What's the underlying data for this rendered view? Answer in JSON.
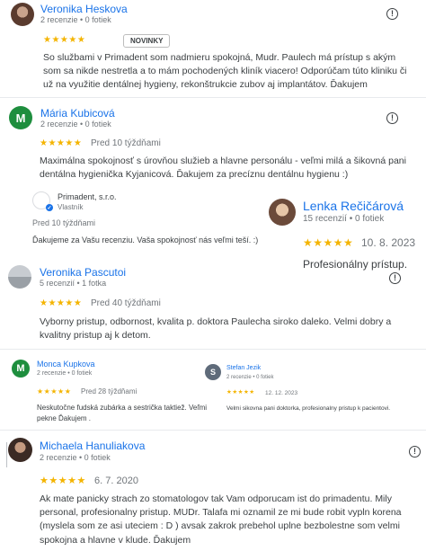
{
  "reviews": [
    {
      "author": "Veronika Heskova",
      "meta": "2 recenzie • 0 fotiek",
      "stars": "★★★★★",
      "badge": "NOVINKY",
      "text": "So službami v Primadent som nadmieru spokojná, Mudr. Paulech má prístup s akým som sa nikde nestretla a to mám pochodených kliník viacero! Odporúčam túto kliniku či už na využitie dentálnej hygieny, rekonštrukcie zubov aj implantátov. Ďakujem"
    },
    {
      "author": "Mária Kubicová",
      "initial": "M",
      "meta": "2 recenzie • 0 fotiek",
      "stars": "★★★★★",
      "date": "Pred 10 týždňami",
      "text": "Maximálna spokojnosť s úrovňou služieb a hlavne personálu - veľmi milá a šikovná pani dentálna hygienička Kyjanicová. Ďakujem za precíznu dentálnu hygienu :)"
    },
    {
      "owner_name": "Primadent, s.r.o.",
      "owner_role": "Vlastník",
      "owner_date": "Pred 10 týždňami",
      "owner_text": "Ďakujeme za Vašu recenziu. Vaša spokojnosť nás veľmi teší. :)"
    },
    {
      "author": "Lenka Rečičárová",
      "meta": "15 recenzií • 0 fotiek",
      "stars": "★★★★★",
      "date": "10. 8. 2023",
      "text": "Profesionálny prístup."
    },
    {
      "author": "Veronika Pascutoi",
      "meta": "5 recenzií • 1 fotka",
      "stars": "★★★★★",
      "date": "Pred 40 týždňami",
      "text": "Vyborny pristup, odbornost, kvalita p. doktora Paulecha siroko daleko. Velmi dobry a kvalitny pristup aj k detom."
    },
    {
      "author": "Monca Kupkova",
      "initial": "M",
      "meta": "2 recenzie • 0 fotiek",
      "stars": "★★★★★",
      "date": "Pred 28 týždňami",
      "text": "Neskutočne fudská zubárka a sestrička taktiež. Veľmi pekne Ďakujem ."
    },
    {
      "author": "Stefan Jezik",
      "initial": "S",
      "meta": "2 recenzie • 0 fotiek",
      "stars": "★★★★★",
      "date": "12. 12. 2023",
      "text": "Velmi sikovna pani doktorka, profesionalny pristup k pacientovi."
    },
    {
      "author": "Michaela Hanuliakova",
      "meta": "2 recenzie • 0 fotiek",
      "stars": "★★★★★",
      "date": "6. 7. 2020",
      "text": "Ak mate panicky strach zo stomatologov tak Vam odporucam ist do primadentu. Mily personal, profesionalny pristup. MUDr. Talafa mi oznamil ze mi bude robit vypln korena (myslela som ze asi uteciem : D ) avsak zakrok prebehol uplne bezbolestne som velmi spokojna a hlavne v klude. Ďakujem"
    }
  ],
  "icons": {
    "flag": "!",
    "owner_verified": "✓"
  },
  "colors": {
    "link": "#1a73e8",
    "star": "#f4b400",
    "avatar_green": "#1e8e3e",
    "avatar_slate": "#5f6b7a"
  }
}
